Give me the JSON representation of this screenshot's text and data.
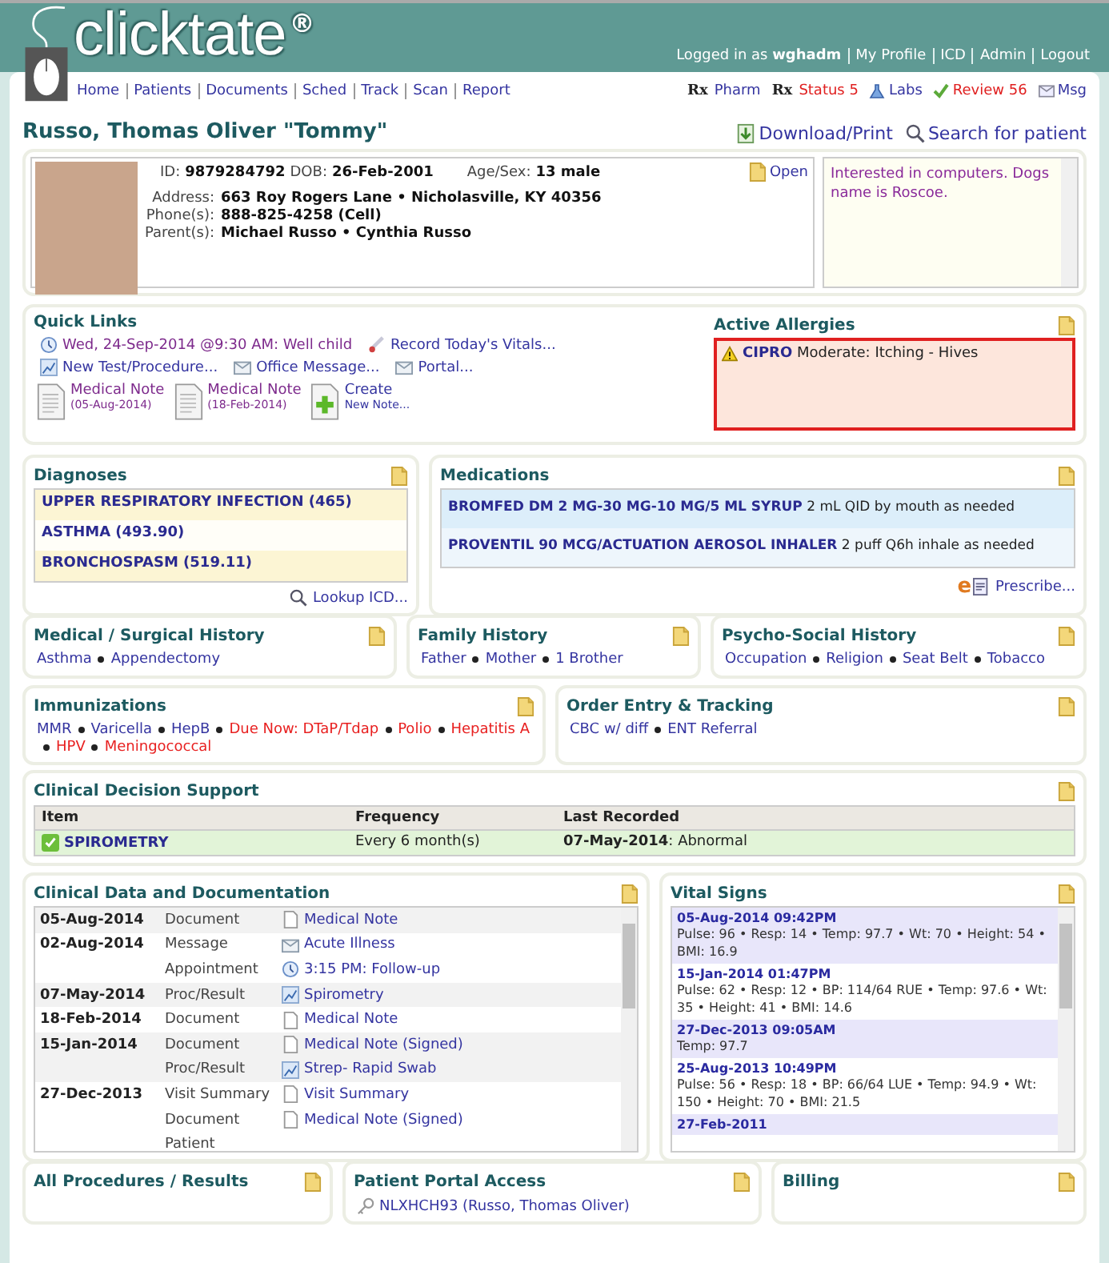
{
  "header": {
    "logo": "clicktate",
    "logo_mark": "®",
    "login_prefix": "Logged in as",
    "username": "wghadm",
    "account_links": [
      "My Profile",
      "ICD",
      "Admin",
      "Logout"
    ]
  },
  "nav": [
    "Home",
    "Patients",
    "Documents",
    "Sched",
    "Track",
    "Scan",
    "Report"
  ],
  "shortcuts": [
    {
      "kind": "rx",
      "prefix": "Rx",
      "label": "Pharm",
      "alert": false
    },
    {
      "kind": "rx",
      "prefix": "Rx",
      "label": "Status 5",
      "alert": true
    },
    {
      "kind": "labs",
      "label": "Labs",
      "alert": false
    },
    {
      "kind": "review",
      "label": "Review 56",
      "alert": true
    },
    {
      "kind": "msg",
      "label": "Msg",
      "alert": false
    }
  ],
  "patient": {
    "name": "Russo, Thomas Oliver \"Tommy\"",
    "download": "Download/Print",
    "search": "Search for patient",
    "id_label": "ID:",
    "id": "9879284792",
    "dob_label": "DOB:",
    "dob": "26-Feb-2001",
    "age_sex_label": "Age/Sex:",
    "age_sex": "13 male",
    "details": [
      {
        "label": "Address:",
        "value": "663 Roy Rogers Lane • Nicholasville, KY 40356"
      },
      {
        "label": "Phone(s):",
        "value": "888-825-4258 (Cell)"
      },
      {
        "label": "Parent(s):",
        "value": "Michael Russo • Cynthia Russo"
      }
    ],
    "open": "Open",
    "note": "Interested in computers. Dogs name is Roscoe."
  },
  "quick_links": {
    "title": "Quick Links",
    "link_rows": [
      [
        {
          "kind": "clock",
          "label": "Wed, 24-Sep-2014 @9:30 AM: Well child",
          "visited": true
        },
        {
          "kind": "thermometer",
          "label": "Record Today's Vitals...",
          "visited": false
        }
      ],
      [
        {
          "kind": "chart",
          "label": "New Test/Procedure...",
          "visited": false
        },
        {
          "kind": "mail",
          "label": "Office Message...",
          "visited": false
        },
        {
          "kind": "mail",
          "label": "Portal...",
          "visited": false
        }
      ]
    ],
    "notes": [
      {
        "kind": "document",
        "title": "Medical Note",
        "subtitle": "(05-Aug-2014)",
        "visited": true
      },
      {
        "kind": "document",
        "title": "Medical Note",
        "subtitle": "(18-Feb-2014)",
        "visited": true
      },
      {
        "kind": "create",
        "title": "Create",
        "subtitle": "New Note...",
        "visited": false
      }
    ]
  },
  "allergies": {
    "title": "Active Allergies",
    "items": [
      {
        "name": "CIPRO",
        "reaction": "Moderate: Itching - Hives"
      }
    ]
  },
  "diagnoses": {
    "title": "Diagnoses",
    "items": [
      "UPPER RESPIRATORY INFECTION (465)",
      "ASTHMA (493.90)",
      "BRONCHOSPASM (519.11)"
    ],
    "action": "Lookup ICD..."
  },
  "medications": {
    "title": "Medications",
    "items": [
      {
        "name": "BROMFED DM 2 MG-30 MG-10 MG/5 ML SYRUP",
        "sig": "2 mL QID by mouth as needed"
      },
      {
        "name": "PROVENTIL 90 MCG/ACTUATION AEROSOL INHALER",
        "sig": "2 puff Q6h inhale as needed"
      }
    ],
    "action_mark": "e",
    "action": "Prescribe..."
  },
  "histories": [
    {
      "title": "Medical / Surgical History",
      "items": [
        "Asthma",
        "Appendectomy"
      ]
    },
    {
      "title": "Family History",
      "items": [
        "Father",
        "Mother",
        "1 Brother"
      ]
    },
    {
      "title": "Psycho-Social History",
      "items": [
        "Occupation",
        "Religion",
        "Seat Belt",
        "Tobacco"
      ]
    }
  ],
  "immunizations": {
    "title": "Immunizations",
    "items": [
      {
        "label": "MMR",
        "due": false
      },
      {
        "label": "Varicella",
        "due": false
      },
      {
        "label": "HepB",
        "due": false
      },
      {
        "label": "Due Now: DTaP/Tdap",
        "due": true
      },
      {
        "label": "Polio",
        "due": true
      },
      {
        "label": "Hepatitis A",
        "due": true
      },
      {
        "label": "HPV",
        "due": true
      },
      {
        "label": "Meningococcal",
        "due": true
      }
    ]
  },
  "orders": {
    "title": "Order Entry & Tracking",
    "items": [
      "CBC w/ diff",
      "ENT Referral"
    ]
  },
  "decision_support": {
    "title": "Clinical Decision Support",
    "columns": [
      "Item",
      "Frequency",
      "Last Recorded"
    ],
    "rows": [
      {
        "item": "SPIROMETRY",
        "frequency": "Every 6 month(s)",
        "last": "**07-May-2014**: Abnormal"
      }
    ]
  },
  "clinical": {
    "title": "Clinical Data and Documentation",
    "groups": [
      {
        "date": "05-Aug-2014",
        "entries": [
          {
            "type": "Document",
            "kind": "document",
            "label": "Medical Note"
          }
        ]
      },
      {
        "date": "02-Aug-2014",
        "entries": [
          {
            "type": "Message",
            "kind": "mail",
            "label": "Acute Illness"
          },
          {
            "type": "Appointment",
            "kind": "clock",
            "label": "3:15 PM: Follow-up"
          }
        ]
      },
      {
        "date": "07-May-2014",
        "entries": [
          {
            "type": "Proc/Result",
            "kind": "chart",
            "label": "Spirometry"
          }
        ]
      },
      {
        "date": "18-Feb-2014",
        "entries": [
          {
            "type": "Document",
            "kind": "document",
            "label": "Medical Note"
          }
        ]
      },
      {
        "date": "15-Jan-2014",
        "entries": [
          {
            "type": "Document",
            "kind": "document",
            "label": "Medical Note (Signed)"
          },
          {
            "type": "Proc/Result",
            "kind": "chart",
            "label": "Strep- Rapid Swab"
          }
        ]
      },
      {
        "date": "27-Dec-2013",
        "entries": [
          {
            "type": "Visit Summary",
            "kind": "document",
            "label": "Visit Summary"
          },
          {
            "type": "Document",
            "kind": "document",
            "label": "Medical Note (Signed)"
          },
          {
            "type": "Patient"
          }
        ]
      }
    ]
  },
  "vitals": {
    "title": "Vital Signs",
    "entries": [
      {
        "datetime": "05-Aug-2014 09:42PM",
        "details": "Pulse: 96 • Resp: 14 • Temp: 97.7 • Wt: 70 • Height: 54 • BMI: 16.9"
      },
      {
        "datetime": "15-Jan-2014 01:47PM",
        "details": "Pulse: 62 • Resp: 12 • BP: 114/64 RUE • Temp: 97.6 • Wt: 35 • Height: 41 • BMI: 14.6"
      },
      {
        "datetime": "27-Dec-2013 09:05AM",
        "details": "Temp: 97.7"
      },
      {
        "datetime": "25-Aug-2013 10:49PM",
        "details": "Pulse: 56 • Resp: 18 • BP: 66/64 LUE • Temp: 94.9 • Wt: 150 • Height: 70 • BMI: 21.5"
      },
      {
        "datetime": "27-Feb-2011"
      }
    ]
  },
  "procedures": {
    "title": "All Procedures / Results"
  },
  "portal": {
    "title": "Patient Portal Access",
    "items": [
      "NLXHCH93 (Russo, Thomas Oliver)"
    ]
  },
  "billing": {
    "title": "Billing"
  }
}
